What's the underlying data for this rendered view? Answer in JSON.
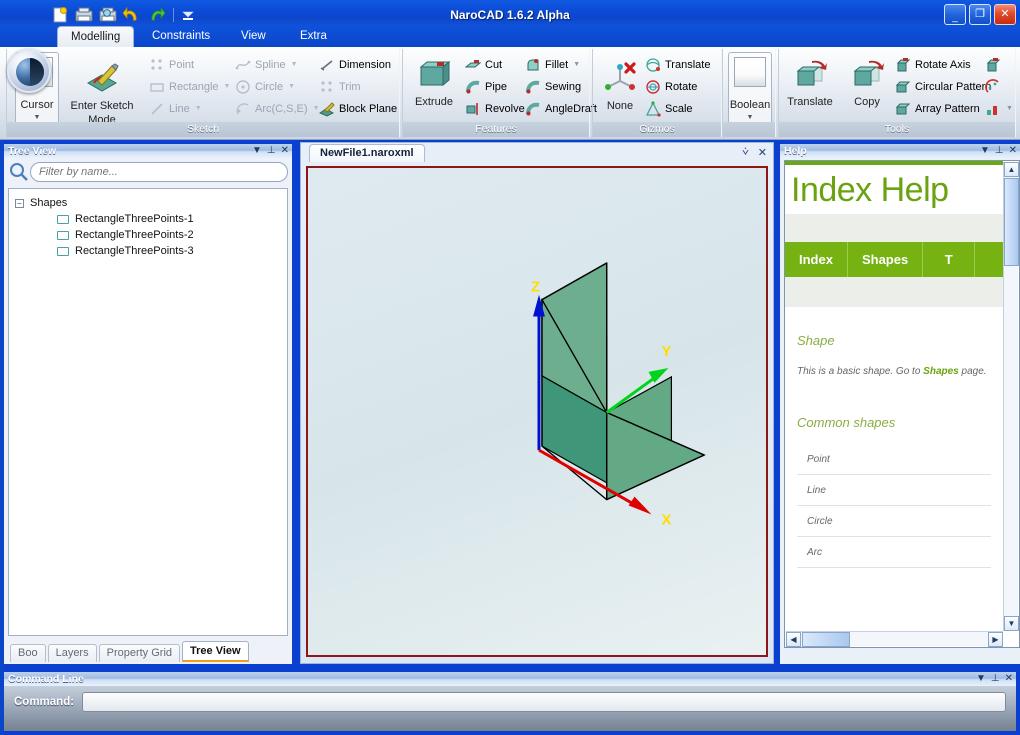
{
  "window": {
    "title": "NaroCAD 1.6.2 Alpha",
    "minimize": "_",
    "maximize": "❐",
    "close": "✕"
  },
  "quick_access": {
    "items": [
      {
        "name": "new-file-icon",
        "tooltip": "New"
      },
      {
        "name": "open-file-icon",
        "tooltip": "Open"
      },
      {
        "name": "save-as-icon",
        "tooltip": "Save As"
      },
      {
        "name": "undo-icon",
        "tooltip": "Undo"
      },
      {
        "name": "redo-icon",
        "tooltip": "Redo"
      }
    ],
    "customize_caret": "▼"
  },
  "ribbon": {
    "tabs": [
      {
        "label": "Modelling",
        "active": true
      },
      {
        "label": "Constraints",
        "active": false
      },
      {
        "label": "View",
        "active": false
      },
      {
        "label": "Extra",
        "active": false
      }
    ],
    "groups": [
      {
        "name": "Sketch",
        "label": "Sketch",
        "dropbox": {
          "label": "Cursor",
          "caret": "▼"
        },
        "big": {
          "label_line1": "Enter Sketch",
          "label_line2": "Mode"
        },
        "items": [
          {
            "label": "Point",
            "icon": "point-icon",
            "disabled": true,
            "caret": ""
          },
          {
            "label": "Rectangle",
            "icon": "rectangle-icon",
            "disabled": true,
            "caret": "▼"
          },
          {
            "label": "Line",
            "icon": "line-icon",
            "disabled": true,
            "caret": "▼"
          },
          {
            "label": "Spline",
            "icon": "spline-icon",
            "disabled": true,
            "caret": "▼"
          },
          {
            "label": "Circle",
            "icon": "circle-icon",
            "disabled": true,
            "caret": "▼"
          },
          {
            "label": "Arc(C,S,E)",
            "icon": "arc-icon",
            "disabled": true,
            "caret": "▼"
          },
          {
            "label": "Dimension",
            "icon": "dimension-icon",
            "disabled": false,
            "caret": ""
          },
          {
            "label": "Trim",
            "icon": "trim-icon",
            "disabled": true,
            "caret": ""
          },
          {
            "label": "Block Plane",
            "icon": "block-plane-icon",
            "disabled": false,
            "caret": ""
          }
        ]
      },
      {
        "name": "Features",
        "label": "Features",
        "big": {
          "label_line1": "Extrude",
          "label_line2": ""
        },
        "items": [
          {
            "label": "Cut",
            "icon": "cut-icon",
            "disabled": false,
            "caret": ""
          },
          {
            "label": "Pipe",
            "icon": "pipe-icon",
            "disabled": false,
            "caret": ""
          },
          {
            "label": "Revolve",
            "icon": "revolve-icon",
            "disabled": false,
            "caret": ""
          },
          {
            "label": "Fillet",
            "icon": "fillet-icon",
            "disabled": false,
            "caret": "▼"
          },
          {
            "label": "Sewing",
            "icon": "sewing-icon",
            "disabled": false,
            "caret": ""
          },
          {
            "label": "AngleDraft",
            "icon": "angledraft-icon",
            "disabled": false,
            "caret": ""
          }
        ]
      },
      {
        "name": "Gizmos",
        "label": "Gizmos",
        "big": {
          "label_line1": "None",
          "label_line2": ""
        },
        "items": [
          {
            "label": "Translate",
            "icon": "translate-gizmo-icon",
            "disabled": false,
            "caret": ""
          },
          {
            "label": "Rotate",
            "icon": "rotate-gizmo-icon",
            "disabled": false,
            "caret": ""
          },
          {
            "label": "Scale",
            "icon": "scale-gizmo-icon",
            "disabled": false,
            "caret": ""
          }
        ]
      },
      {
        "name": "Boolean",
        "label": "",
        "dropbox": {
          "label": "Boolean",
          "caret": "▼"
        }
      },
      {
        "name": "Tools",
        "label": "Tools",
        "big1": {
          "label_line1": "Translate",
          "label_line2": ""
        },
        "big2": {
          "label_line1": "Copy",
          "label_line2": ""
        },
        "items": [
          {
            "label": "Rotate Axis",
            "icon": "rotate-axis-icon",
            "disabled": false,
            "caret": ""
          },
          {
            "label": "Circular Pattern",
            "icon": "circular-pattern-icon",
            "disabled": false,
            "caret": ""
          },
          {
            "label": "Array Pattern",
            "icon": "array-pattern-icon",
            "disabled": false,
            "caret": ""
          }
        ],
        "trailing_icons": [
          {
            "name": "mirror-icon"
          },
          {
            "name": "circular-pattern-alt-icon"
          },
          {
            "name": "array-pattern-alt-icon",
            "caret": "▼"
          }
        ]
      }
    ]
  },
  "tree_view": {
    "title": "Tree View",
    "header_buttons": {
      "dropdown": "▼",
      "pin": "⊥",
      "close": "✕"
    },
    "search": {
      "placeholder": "Filter by name...",
      "value": "",
      "icon": "search-icon"
    },
    "root": {
      "label": "Shapes",
      "expander": "−"
    },
    "children": [
      {
        "label": "RectangleThreePoints-1",
        "icon": "rectangle-shape-icon"
      },
      {
        "label": "RectangleThreePoints-2",
        "icon": "rectangle-shape-icon"
      },
      {
        "label": "RectangleThreePoints-3",
        "icon": "rectangle-shape-icon"
      }
    ],
    "tabs": [
      {
        "label": "Boo",
        "active": false
      },
      {
        "label": "Layers",
        "active": false
      },
      {
        "label": "Property Grid",
        "active": false
      },
      {
        "label": "Tree View",
        "active": true
      }
    ]
  },
  "document": {
    "tab_label": "NewFile1.naroxml",
    "tab_buttons": {
      "dropdown": "⩒",
      "close": "✕"
    },
    "viewport": {
      "axes": [
        {
          "label": "X",
          "color": "#e00000"
        },
        {
          "label": "Y",
          "color": "#00d41a"
        },
        {
          "label": "Z",
          "color": "#0012d0"
        }
      ],
      "axis_label_color": "#ffdd00",
      "shape_fill": "#5aa884",
      "shape_edge": "#000000",
      "background": "#dde9ee",
      "border_color": "#8f1616"
    }
  },
  "help": {
    "title": "Help",
    "header_buttons": {
      "dropdown": "▼",
      "pin": "⊥",
      "close": "✕"
    },
    "page_title": "Index Help",
    "nav": [
      {
        "label": "Index"
      },
      {
        "label": "Shapes"
      },
      {
        "label": "T"
      }
    ],
    "section_title": "Shape",
    "paragraph_pre": "This is a basic shape. Go to ",
    "paragraph_link": "Shapes",
    "paragraph_post": " page.",
    "subsection_title": "Common shapes",
    "list": [
      {
        "label": "Point"
      },
      {
        "label": "Line"
      },
      {
        "label": "Circle"
      },
      {
        "label": "Arc"
      }
    ],
    "scroll": {
      "up": "▲",
      "down": "▼",
      "left": "◀",
      "right": "▶"
    },
    "accent_color": "#76b211"
  },
  "command_line": {
    "title": "Command Line",
    "header_buttons": {
      "dropdown": "▼",
      "pin": "⊥",
      "close": "✕"
    },
    "label": "Command:",
    "value": "",
    "placeholder": ""
  }
}
